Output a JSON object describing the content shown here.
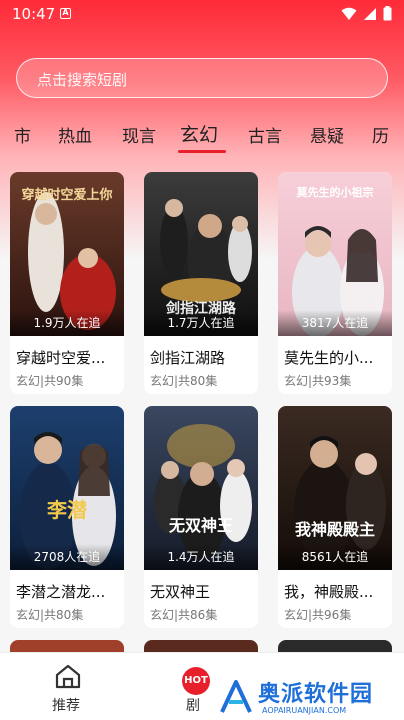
{
  "status_bar": {
    "time": "10:47",
    "notif_letter": "A"
  },
  "search": {
    "placeholder": "点击搜索短剧"
  },
  "tabs": [
    {
      "label": "市"
    },
    {
      "label": "热血"
    },
    {
      "label": "现言"
    },
    {
      "label": "玄幻",
      "active": true
    },
    {
      "label": "古言"
    },
    {
      "label": "悬疑"
    },
    {
      "label": "历"
    }
  ],
  "cards": [
    {
      "title": "穿越时空爱...",
      "meta": "玄幻|共90集",
      "followers": "1.9万人在追",
      "poster_text": "穿越时空爱上你"
    },
    {
      "title": "剑指江湖路",
      "meta": "玄幻|共80集",
      "followers": "1.7万人在追",
      "poster_text": "剑指江湖路"
    },
    {
      "title": "莫先生的小...",
      "meta": "玄幻|共93集",
      "followers": "3817人在追",
      "poster_text": "莫先生的小祖宗"
    },
    {
      "title": "李潜之潜龙...",
      "meta": "玄幻|共80集",
      "followers": "2708人在追",
      "poster_text": "李潜"
    },
    {
      "title": "无双神王",
      "meta": "玄幻|共86集",
      "followers": "1.4万人在追",
      "poster_text": "无双神王"
    },
    {
      "title": "我，神殿殿...",
      "meta": "玄幻|共96集",
      "followers": "8561人在追",
      "poster_text": "我神殿殿主"
    }
  ],
  "bottom_nav": {
    "home_label": "推荐",
    "drama_label": "剧",
    "hot_badge": "HOT"
  },
  "watermark": {
    "text": "奥派软件园",
    "sub": "AOPAIRUANJIAN.COM"
  },
  "colors": {
    "accent": "#e8202c",
    "header_top": "#ff2a38"
  }
}
